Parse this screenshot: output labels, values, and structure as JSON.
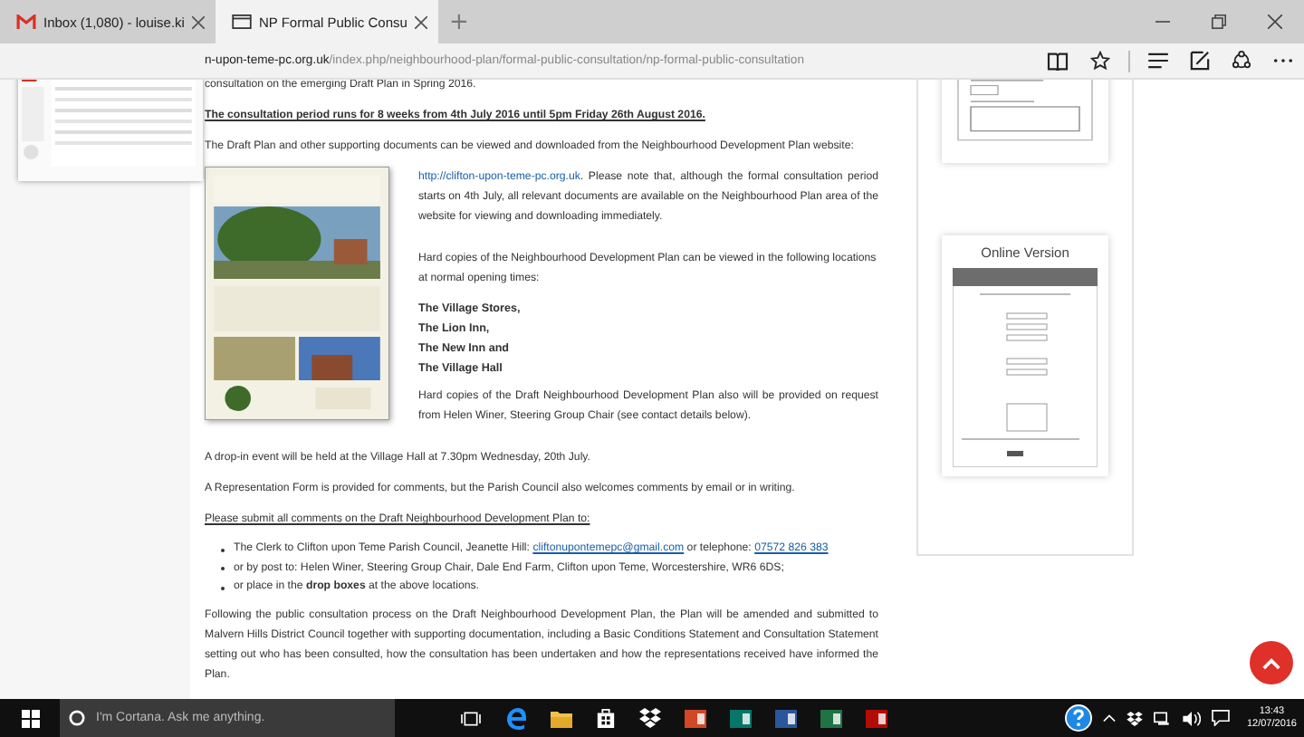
{
  "browser": {
    "tabs": [
      {
        "label": "Inbox (1,080) - louise.ki",
        "selected": false
      },
      {
        "label": "NP Formal Public Consu",
        "selected": true
      }
    ],
    "new_tab": "+",
    "address": {
      "domain": "n-upon-teme-pc.org.uk",
      "path": "/index.php/neighbourhood-plan/formal-public-consultation/np-formal-public-consultation"
    }
  },
  "article": {
    "intro_cut": "consultation on the emerging Draft Plan in Spring 2016.",
    "notice": "The consultation period runs for 8 weeks from 4th July 2016 until 5pm Friday 26th August 2016.",
    "lead": "The Draft Plan and other supporting documents can be viewed and downloaded from the Neighbourhood Development Plan website:",
    "feature": {
      "link": "http://clifton-upon-teme-pc.org.uk",
      "link_tail": ". Please note that, although the formal consultation period starts on 4th July, all relevant documents are available on the Neighbourhood Plan area of the website for viewing and downloading immediately.",
      "copies_text": "Hard copies of the Neighbourhood Development Plan can be viewed in the following locations at normal opening times:",
      "locations": [
        "The Village Stores,",
        "The Lion Inn,",
        "The New Inn and",
        "The Village Hall"
      ],
      "request_text": "Hard copies of the Draft Neighbourhood Development Plan also will be provided on request from Helen Winer, Steering Group Chair (see contact details below)."
    },
    "paragraphs": [
      "A drop-in event will be held at the Village Hall at 7.30pm Wednesday, 20th July.",
      "A Representation Form is provided for comments, but the Parish Council also welcomes comments by email or in writing."
    ],
    "submit_heading": "Please submit all comments on the Draft Neighbourhood Development Plan to:",
    "bullets": [
      {
        "kind": "contact",
        "text": "The Clerk to Clifton upon Teme Parish Council, Jeanette Hill: ",
        "email": "cliftonupontemepc@gmail.com",
        "between": " or telephone: ",
        "phone": "07572 826 383"
      },
      {
        "kind": "plain",
        "text": "or by post to: Helen Winer, Steering Group Chair, Dale End Farm, Clifton upon Teme, Worcestershire, WR6 6DS;"
      },
      {
        "kind": "plain",
        "text": "or place in the **drop boxes** at the above locations."
      }
    ],
    "closing": "Following the public consultation process on the Draft Neighbourhood Development Plan, the Plan will be amended and submitted to Malvern Hills District Council together with supporting documentation, including a Basic Conditions Statement and Consultation Statement setting out who has been consulted, how the consultation has been undertaken and how the representations received have informed the Plan."
  },
  "sidebar": {
    "online_title": "Online Version"
  },
  "taskbar": {
    "search_placeholder": "I'm Cortana. Ask me anything.",
    "apps": [
      {
        "kind": "taskview"
      },
      {
        "kind": "edge"
      },
      {
        "kind": "folder"
      },
      {
        "kind": "store"
      },
      {
        "kind": "dropbox"
      },
      {
        "kind": "powerpoint"
      },
      {
        "kind": "publisher"
      },
      {
        "kind": "word"
      },
      {
        "kind": "excel"
      },
      {
        "kind": "acrobat"
      }
    ],
    "time": "13:43",
    "date": "12/07/2016"
  }
}
